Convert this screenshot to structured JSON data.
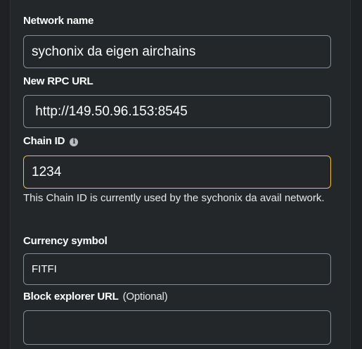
{
  "network_name": {
    "label": "Network name",
    "value": "sychonix da eigen airchains"
  },
  "rpc_url": {
    "label": "New RPC URL",
    "value": " http://149.50.96.153:8545"
  },
  "chain_id": {
    "label": "Chain ID",
    "info_icon": "info-icon",
    "value": "1234",
    "help_text": "This Chain ID is currently used by the sychonix da avail network."
  },
  "currency_symbol": {
    "label": "Currency symbol",
    "value": "FITFI"
  },
  "block_explorer": {
    "label": "Block explorer URL",
    "optional": "(Optional)",
    "value": ""
  },
  "colors": {
    "background": "#24272a",
    "field_border": "#858b92",
    "focus_border": "#f0bf3c",
    "text": "#ffffff"
  }
}
